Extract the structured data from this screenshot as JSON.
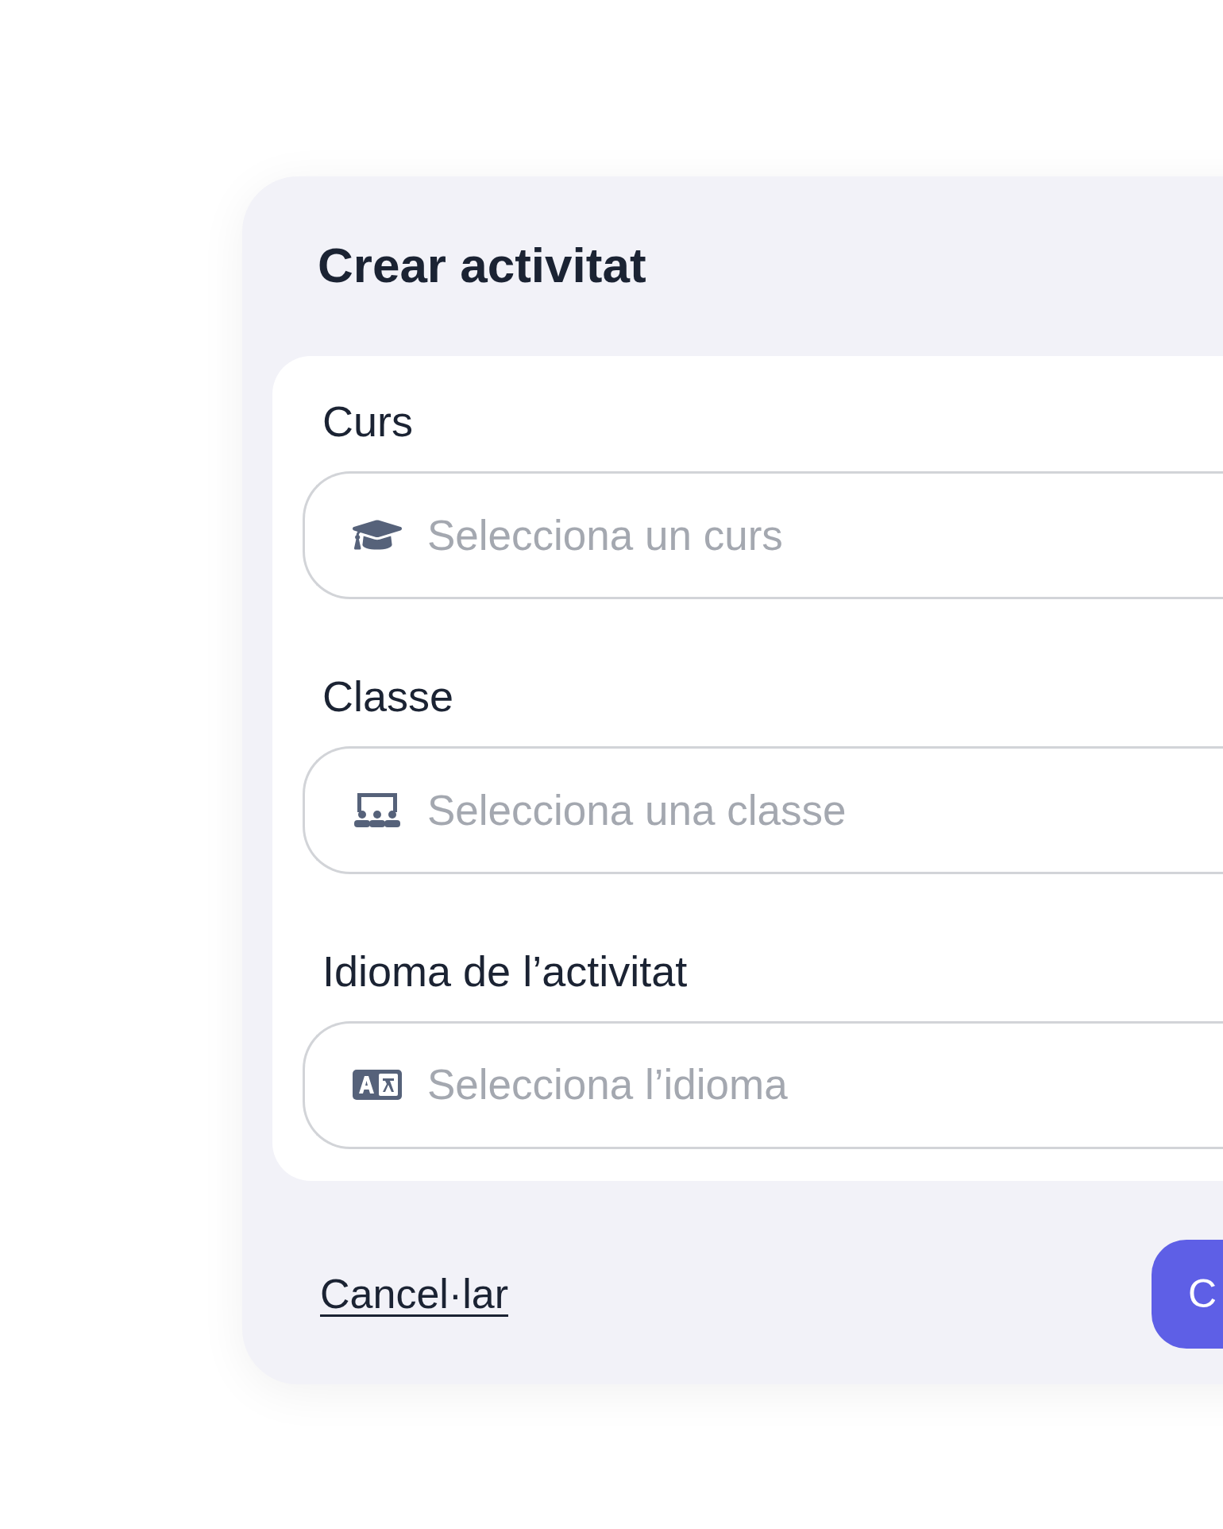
{
  "dialog": {
    "title": "Crear activitat",
    "fields": [
      {
        "kind": "course",
        "label": "Curs",
        "placeholder": "Selecciona un curs"
      },
      {
        "kind": "class",
        "label": "Classe",
        "placeholder": "Selecciona una classe"
      },
      {
        "kind": "language",
        "label": "Idioma de l’activitat",
        "placeholder": "Selecciona l’idioma"
      }
    ],
    "cancel": "Cancel·lar",
    "confirm": "C"
  }
}
